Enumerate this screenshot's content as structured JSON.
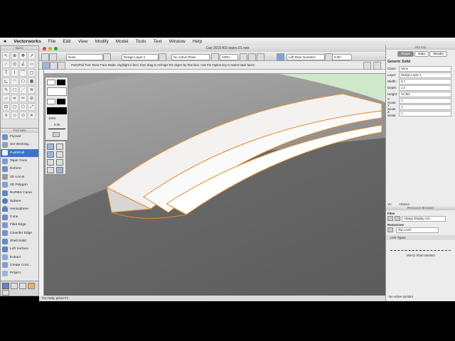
{
  "menubar": {
    "app": "Vectorworks",
    "items": [
      "File",
      "Edit",
      "View",
      "Modify",
      "Model",
      "Tools",
      "Text",
      "Window",
      "Help"
    ]
  },
  "document": {
    "title": "Csp-2015-f02-stairs-01.vwx"
  },
  "palettes": {
    "basic_title": "Basic",
    "toolsets_title": "Tool Sets",
    "attributes_scale": "100%",
    "attributes_thickness": "0.05"
  },
  "viewbar": {
    "class_value": "None",
    "layer_value": "Design Layer-1",
    "plane_value": "No Active Plane",
    "zoom_value": "100%",
    "view_value": "Left Rear Isometric",
    "angle_value": "0.00°"
  },
  "modebar": {
    "hint": "Push/Pull Tool: Move Face Mode. Highlight a face, then drag to reshape the object by that face. Use the Option key to select back faces."
  },
  "status": {
    "help": "For Help, press F1"
  },
  "toolsets": [
    "Flyover",
    "Set Working...",
    "Push/Pull",
    "Taper Face",
    "Deform",
    "3D Locus",
    "3D Polygon",
    "NURBS Curve",
    "Sphere",
    "Hemisphere",
    "Cone",
    "Fillet Edge",
    "Chamfer Edge",
    "Shell Solid",
    "Loft Surface",
    "Extract",
    "Create Cont...",
    "Project"
  ],
  "toolset_selected": "Push/Pull",
  "basic_tools": [
    "↖",
    "⊕",
    "✥",
    "↗",
    "∕",
    "⊙",
    "∠",
    "▭",
    "T",
    "⌇",
    "⌒",
    "▢",
    "◺",
    "◠",
    "⬠",
    "▦",
    "✎",
    "◻",
    "⋰",
    "≋",
    "▱",
    "⌗",
    "✂",
    "⊘",
    "⊡",
    "▢",
    "⬡",
    "⤢",
    "≡",
    "◇",
    "⬭",
    "✕"
  ],
  "objinfo": {
    "title": "Obj Info",
    "tabs": [
      "Shape",
      "Data",
      "Render"
    ],
    "selected_tab": "Shape",
    "object_type": "Generic Solid",
    "fields": [
      {
        "label": "Class:",
        "value": "None"
      },
      {
        "label": "Layer:",
        "value": "Design Layer-1"
      },
      {
        "label": "Width:",
        "value": "6.7"
      },
      {
        "label": "Depth:",
        "value": "1.2"
      },
      {
        "label": "Height:",
        "value": "16.351"
      },
      {
        "label": "X Scale:",
        "value": "1"
      },
      {
        "label": "Y Scale:",
        "value": "1"
      },
      {
        "label": "Z Scale:",
        "value": "1"
      }
    ]
  },
  "resource_browser": {
    "title": "Resource Browser",
    "pane_prefix": "VC",
    "pane_value": "<None>",
    "files_label": "Files",
    "files_value": "Always Display Acti...",
    "resources_label": "Resources",
    "resources_value": "Top Level",
    "section": "Line Types",
    "item_name": "VW-01 Short Dashed",
    "active_label": "No Active Symbol"
  },
  "colors": {
    "accent": "#3b73c7",
    "highlight_edge": "#e08a2a",
    "canvas": "#8c8c8c",
    "ground": "#cfe8c9"
  }
}
